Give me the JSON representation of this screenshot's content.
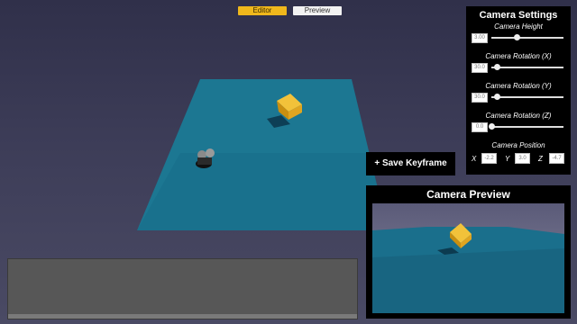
{
  "mode_tabs": {
    "editor": "Editor",
    "preview": "Preview"
  },
  "settings": {
    "title": "Camera Settings",
    "camera_height": {
      "label": "Camera Height",
      "value": "3.00",
      "slider": 0.35
    },
    "rotation_x": {
      "label": "Camera Rotation (X)",
      "value": "30.0",
      "slider": 0.08
    },
    "rotation_y": {
      "label": "Camera Rotation (Y)",
      "value": "30.0",
      "slider": 0.08
    },
    "rotation_z": {
      "label": "Camera Rotation (Z)",
      "value": "0.0",
      "slider": 0.0
    },
    "position": {
      "label": "Camera Position",
      "x_label": "X",
      "x": "-2.2",
      "y_label": "Y",
      "y": "3.0",
      "z_label": "Z",
      "z": "-4.7"
    }
  },
  "save_keyframe": "+ Save Keyframe",
  "preview": {
    "title": "Camera Preview"
  },
  "colors": {
    "accent": "#f0b81c",
    "plane": "#1a7a96",
    "cube": "#e0a520"
  }
}
